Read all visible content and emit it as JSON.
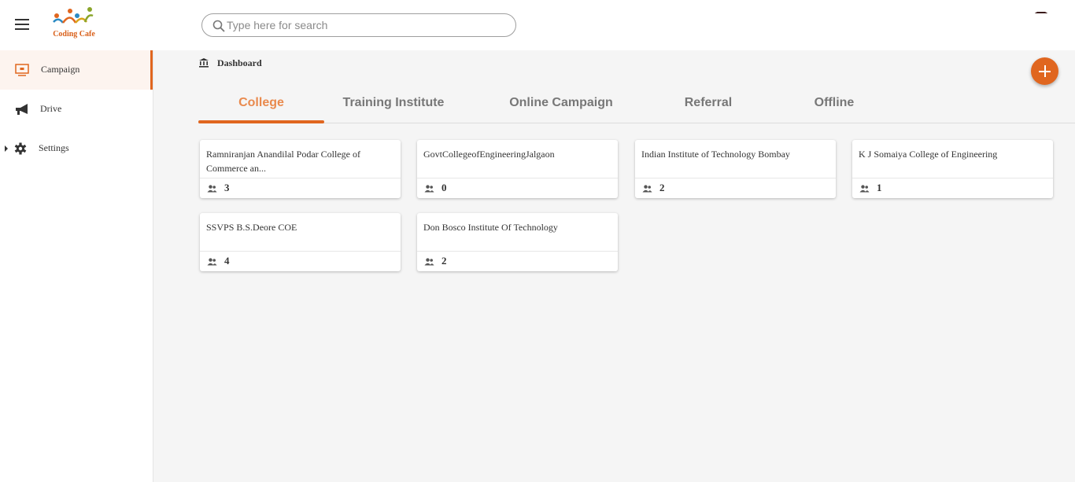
{
  "app": {
    "brand": "Coding Cafe",
    "search_placeholder": "Type here for search"
  },
  "sidebar": {
    "items": [
      {
        "label": "Campaign",
        "icon": "monitor-icon",
        "active": true
      },
      {
        "label": "Drive",
        "icon": "megaphone-icon",
        "active": false
      },
      {
        "label": "Settings",
        "icon": "gear-icon",
        "active": false
      }
    ]
  },
  "breadcrumb": {
    "label": "Dashboard",
    "icon": "bank-icon"
  },
  "tabs": [
    {
      "label": "College",
      "active": true
    },
    {
      "label": "Training Institute",
      "active": false
    },
    {
      "label": "Online Campaign",
      "active": false
    },
    {
      "label": "Referral",
      "active": false
    },
    {
      "label": "Offline",
      "active": false
    }
  ],
  "cards": [
    {
      "title": "Ramniranjan Anandilal Podar College of Commerce an...",
      "count": "3"
    },
    {
      "title": "GovtCollegeofEngineeringJalgaon",
      "count": "0"
    },
    {
      "title": "Indian Institute of Technology Bombay",
      "count": "2"
    },
    {
      "title": "K J Somaiya College of Engineering",
      "count": "1"
    },
    {
      "title": "SSVPS B.S.Deore COE",
      "count": "4"
    },
    {
      "title": "Don Bosco Institute Of Technology",
      "count": "2"
    }
  ],
  "colors": {
    "accent": "#e0661f",
    "active_tab_text": "#e98a4e",
    "main_bg": "#f5f5f5"
  }
}
